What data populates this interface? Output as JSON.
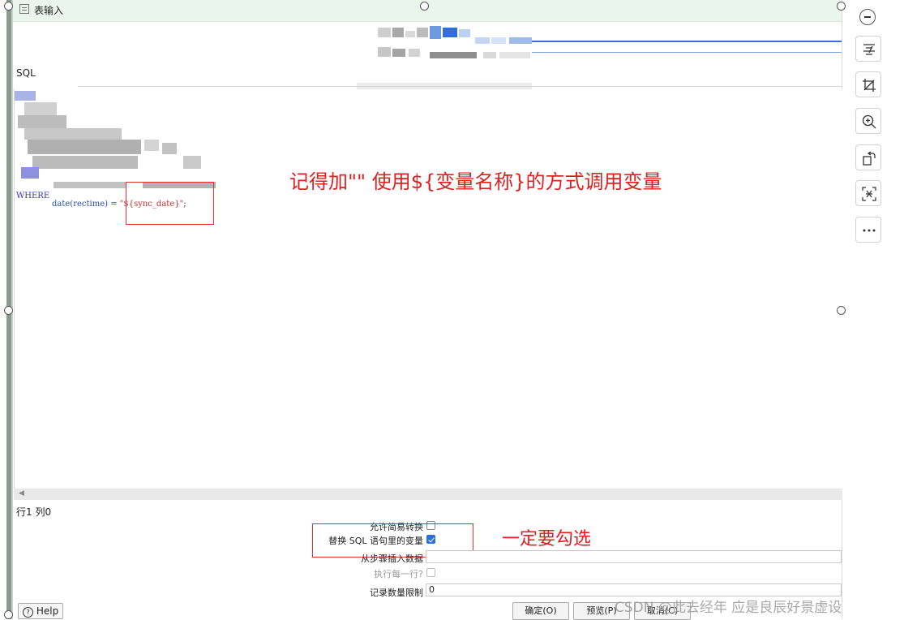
{
  "window": {
    "title": "表输入"
  },
  "sql": {
    "label": "SQL",
    "where_keyword": "WHERE",
    "where_expr": "date(rectime) = ",
    "where_value": "\"${sync_date}\"",
    "where_end": ";"
  },
  "annotations": {
    "variable_tip": "记得加\"\" 使用${变量名称}的方式调用变量",
    "checkbox_tip": "一定要勾选"
  },
  "status": {
    "position": "行1 列0"
  },
  "options": {
    "lazy_conversion": {
      "label": "允许简易转换",
      "checked": false
    },
    "replace_vars": {
      "label": "替换 SQL 语句里的变量",
      "checked": true
    },
    "insert_from_step": {
      "label": "从步骤插入数据",
      "value": ""
    },
    "execute_each_row": {
      "label": "执行每一行?",
      "checked": false
    },
    "limit": {
      "label": "记录数量限制",
      "value": "0"
    }
  },
  "buttons": {
    "help": "Help",
    "ok": "确定(O)",
    "preview": "预览(P)",
    "cancel": "取消(C)"
  },
  "toolbar": {
    "icons": [
      "minus-icon",
      "align-icon",
      "crop-icon",
      "zoom-in-icon",
      "rotate-icon",
      "text-extract-icon",
      "more-icon"
    ]
  },
  "watermark": "CSDN @此去经年 应是良辰好景虚设",
  "colors": {
    "annotation": "#e02020",
    "checkbox_accent": "#2c6fd8",
    "keyword": "#3333bb",
    "string": "#c03030"
  }
}
